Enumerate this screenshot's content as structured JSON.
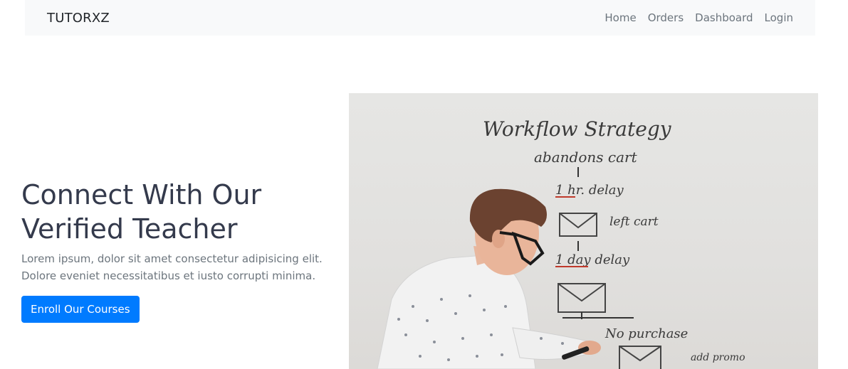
{
  "navbar": {
    "brand": "TUTORXZ",
    "links": [
      "Home",
      "Orders",
      "Dashboard",
      "Login"
    ]
  },
  "hero": {
    "title_line1": "Connect With Our",
    "title_line2": "Verified Teacher",
    "text_line1": "Lorem ipsum, dolor sit amet consectetur adipisicing elit.",
    "text_line2": "Dolore eveniet necessitatibus et iusto corrupti minima.",
    "button_label": "Enroll Our Courses"
  },
  "image": {
    "whiteboard_title": "Workflow Strategy",
    "notes": [
      "abandons cart",
      "1 hr. delay",
      "left cart",
      "1 day delay",
      "No purchase",
      "add promo"
    ]
  },
  "colors": {
    "primary": "#007bff",
    "navbar_bg": "#f8f9fa",
    "heading": "#343a4c",
    "muted": "#6c757d"
  }
}
